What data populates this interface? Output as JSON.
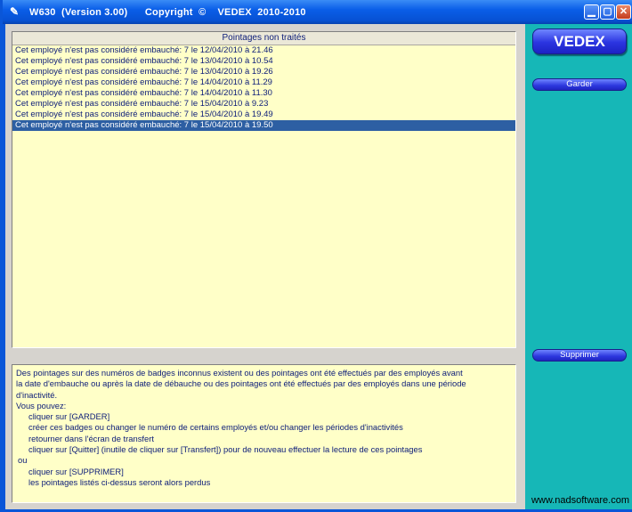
{
  "window": {
    "title": "W630  (Version 3.00)      Copyright  ©    VEDEX  2010-2010",
    "icon": "pencil-icon",
    "controls": [
      "minimize-icon",
      "maximize-icon",
      "close-icon"
    ]
  },
  "list": {
    "header": "Pointages non traités",
    "rows": [
      "Cet employé n'est pas considéré embauché: 7 le 12/04/2010 à 21.46",
      "Cet employé n'est pas considéré embauché: 7 le 13/04/2010 à 10.54",
      "Cet employé n'est pas considéré embauché: 7 le 13/04/2010 à 19.26",
      "Cet employé n'est pas considéré embauché: 7 le 14/04/2010 à 11.29",
      "Cet employé n'est pas considéré embauché: 7 le 14/04/2010 à 11.30",
      "Cet employé n'est pas considéré embauché: 7 le 15/04/2010 à  9.23",
      "Cet employé n'est pas considéré embauché: 7 le 15/04/2010 à 19.49",
      "Cet employé n'est pas considéré embauché: 7 le 15/04/2010 à 19.50"
    ],
    "selected_index": 7
  },
  "info": {
    "lines": [
      "Des pointages sur des numéros de badges inconnus existent ou des pointages ont été effectués par des employés avant",
      "la date d'embauche ou après la date de débauche ou des pointages ont été effectués par des employés dans une période",
      "d'inactivité.",
      "Vous pouvez:",
      "cliquer sur [GARDER]",
      "créer ces badges ou changer le numéro de certains employés et/ou changer les périodes d'inactivités",
      "retourner dans l'écran de transfert",
      "cliquer sur [Quitter] (inutile de cliquer sur [Transfert]) pour de nouveau effectuer la lecture de ces pointages",
      "ou",
      "cliquer sur [SUPPRIMER]",
      "les pointages listés ci-dessus seront alors perdus"
    ]
  },
  "sidebar": {
    "logo": "VEDEX",
    "garder_label": "Garder",
    "supprimer_label": "Supprimer"
  },
  "watermark": "www.nadsoftware.com"
}
